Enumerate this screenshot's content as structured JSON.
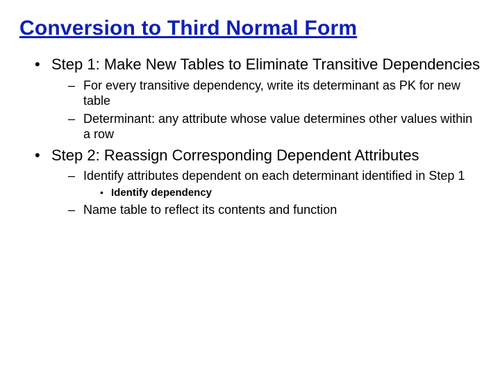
{
  "title": "Conversion to Third Normal Form",
  "bullets": [
    {
      "text": "Step 1: Make New Tables to Eliminate Transitive Dependencies",
      "sub": [
        {
          "text": "For every transitive dependency, write its determinant as PK for new table"
        },
        {
          "text": "Determinant: any attribute whose value determines other values within a row"
        }
      ]
    },
    {
      "text": "Step 2: Reassign Corresponding Dependent Attributes",
      "sub": [
        {
          "text": "Identify attributes dependent on each determinant identified in Step 1",
          "subsub": [
            {
              "text": "Identify dependency"
            }
          ]
        },
        {
          "text": "Name table to reflect its contents and function"
        }
      ]
    }
  ]
}
